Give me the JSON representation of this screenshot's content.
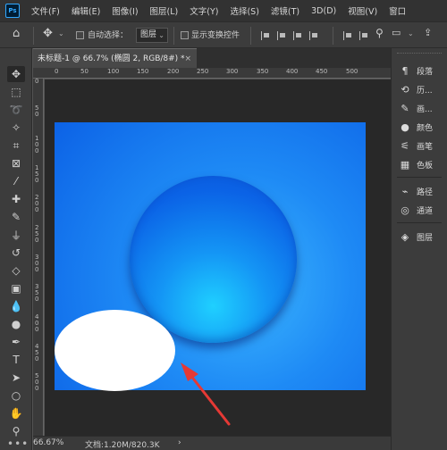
{
  "app": {
    "logo": "Ps"
  },
  "menu": [
    "文件(F)",
    "编辑(E)",
    "图像(I)",
    "图层(L)",
    "文字(Y)",
    "选择(S)",
    "滤镜(T)",
    "3D(D)",
    "视图(V)",
    "窗口"
  ],
  "options": {
    "auto_select_label": "自动选择：",
    "auto_select_value": "图层",
    "show_transform_label": "显示变换控件"
  },
  "document": {
    "tab_title": "未标题-1 @ 66.7% (椭圆 2, RGB/8#) *",
    "close_glyph": "×"
  },
  "ruler": {
    "top": [
      "0",
      "50",
      "100",
      "150",
      "200",
      "250",
      "300",
      "350",
      "400",
      "450",
      "500"
    ],
    "left": [
      "0",
      "5 0",
      "1 0 0",
      "1 5 0",
      "2 0 0",
      "2 5 0",
      "3 0 0",
      "3 5 0",
      "4 0 0",
      "4 5 0",
      "5 0 0"
    ]
  },
  "status": {
    "zoom": "66.67%",
    "doc_info": "文档:1.20M/820.3K",
    "arrow": "›"
  },
  "panels": [
    {
      "icon": "paragraph-icon",
      "glyph": "¶",
      "label": "段落"
    },
    {
      "icon": "history-icon",
      "glyph": "⟲",
      "label": "历..."
    },
    {
      "icon": "brush-icon",
      "glyph": "✎",
      "label": "画..."
    },
    {
      "icon": "color-icon",
      "glyph": "●",
      "label": "颜色"
    },
    {
      "icon": "brushes-icon",
      "glyph": "⚟",
      "label": "画笔"
    },
    {
      "icon": "swatches-icon",
      "glyph": "▦",
      "label": "色板"
    },
    {
      "icon": "paths-icon",
      "glyph": "⌁",
      "label": "路径"
    },
    {
      "icon": "channels-icon",
      "glyph": "◎",
      "label": "通道"
    },
    {
      "icon": "layers-icon",
      "glyph": "◈",
      "label": "图层"
    }
  ],
  "colors": {
    "canvas_edge": "#0c62e6",
    "canvas_center": "#3db8ff",
    "arrow": "#e53935",
    "ellipse": "#ffffff"
  }
}
